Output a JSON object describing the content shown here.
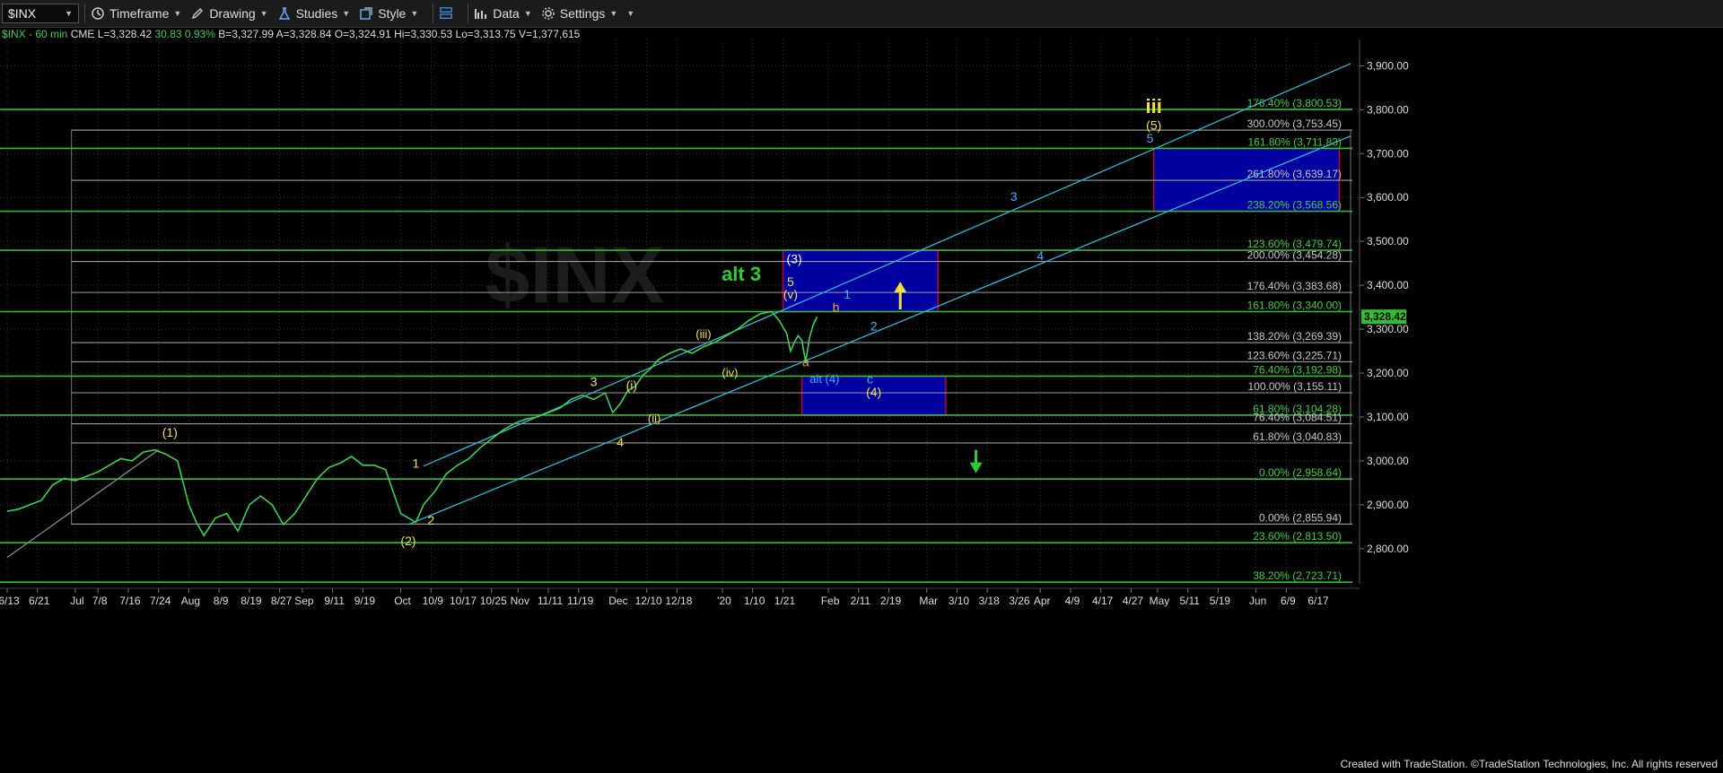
{
  "toolbar": {
    "symbol": "$INX",
    "timeframe_label": "Timeframe",
    "drawing_label": "Drawing",
    "studies_label": "Studies",
    "style_label": "Style",
    "data_label": "Data",
    "settings_label": "Settings"
  },
  "quote": {
    "symbol_interval": "$INX - 60 min",
    "exchange": "CME",
    "last": "L=3,328.42",
    "change": "30.83",
    "change_pct": "0.93%",
    "bid": "B=3,327.99",
    "ask": "A=3,328.84",
    "open": "O=3,324.91",
    "high": "Hi=3,330.53",
    "low": "Lo=3,313.75",
    "volume": "V=1,377,615"
  },
  "footer": {
    "credit": "Created with TradeStation. ©TradeStation Technologies, Inc. All rights reserved"
  },
  "colors": {
    "background": "#000000",
    "grid": "#2a3a2a",
    "price": "#39d353",
    "level_green": "#2fbf2f",
    "level_gray": "#9a9a9a",
    "channel": "#2fb8d8",
    "box_fill": "#0000a0",
    "box_border": "#c00030",
    "yellow": "#f0e040",
    "cyan": "#40b0ff",
    "orange": "#f0a030"
  },
  "chart_data": {
    "type": "line",
    "title": "",
    "xlabel": "",
    "ylabel": "",
    "watermark": "$INX",
    "ylim": [
      2720,
      3960
    ],
    "y_ticks": [
      "2,800.00",
      "2,900.00",
      "3,000.00",
      "3,100.00",
      "3,200.00",
      "3,300.00",
      "3,400.00",
      "3,500.00",
      "3,600.00",
      "3,700.00",
      "3,800.00",
      "3,900.00"
    ],
    "y_tick_values": [
      2800,
      2900,
      3000,
      3100,
      3200,
      3300,
      3400,
      3500,
      3600,
      3700,
      3800,
      3900
    ],
    "last_price_label": "3,328.42",
    "last_price": 3328.42,
    "x_labels": [
      "6/13",
      "6/21",
      "Jul",
      "7/8",
      "7/16",
      "7/24",
      "Aug",
      "8/9",
      "8/19",
      "8/27",
      "Sep",
      "9/11",
      "9/19",
      "Oct",
      "10/9",
      "10/17",
      "10/25",
      "Nov",
      "11/11",
      "11/19",
      "Dec",
      "12/10",
      "12/18",
      "'20",
      "1/10",
      "1/21",
      "Feb",
      "2/11",
      "2/19",
      "Mar",
      "3/10",
      "3/18",
      "3/26",
      "Apr",
      "4/9",
      "4/17",
      "4/27",
      "May",
      "5/11",
      "5/19",
      "Jun",
      "6/9",
      "6/17"
    ],
    "x_index": [
      0,
      8,
      18,
      24,
      32,
      40,
      48,
      56,
      64,
      72,
      78,
      86,
      94,
      104,
      112,
      120,
      128,
      135,
      143,
      151,
      161,
      169,
      177,
      189,
      197,
      205,
      217,
      225,
      233,
      243,
      251,
      259,
      267,
      273,
      281,
      289,
      297,
      304,
      312,
      320,
      330,
      338,
      346
    ],
    "x_max": 355,
    "series": [
      {
        "values_note": "",
        "x": [
          0,
          3,
          6,
          9,
          12,
          15,
          18,
          21,
          24,
          27,
          30,
          33,
          36,
          39,
          42,
          45,
          48,
          50,
          52,
          55,
          58,
          61,
          64,
          67,
          70,
          73,
          76,
          79,
          82,
          85,
          88,
          91,
          94,
          97,
          100,
          102,
          104,
          106,
          108,
          110,
          113,
          116,
          119,
          122,
          125,
          128,
          131,
          134,
          137,
          140,
          143,
          146,
          149,
          152,
          155,
          158,
          160,
          162,
          164,
          166,
          168,
          170,
          172,
          175,
          178,
          181,
          184,
          187,
          190,
          193,
          196,
          199,
          202,
          204,
          206,
          207,
          208,
          209,
          210,
          211,
          212,
          213,
          214
        ],
        "y": [
          2885,
          2890,
          2900,
          2910,
          2945,
          2960,
          2955,
          2965,
          2975,
          2990,
          3005,
          3000,
          3020,
          3025,
          3015,
          3000,
          2900,
          2860,
          2830,
          2870,
          2880,
          2840,
          2900,
          2920,
          2900,
          2855,
          2880,
          2920,
          2960,
          2985,
          2995,
          3010,
          2990,
          2990,
          2980,
          2930,
          2880,
          2870,
          2860,
          2900,
          2930,
          2970,
          2990,
          3005,
          3030,
          3050,
          3070,
          3085,
          3095,
          3100,
          3110,
          3120,
          3140,
          3150,
          3140,
          3155,
          3110,
          3130,
          3160,
          3170,
          3195,
          3210,
          3230,
          3245,
          3255,
          3245,
          3260,
          3270,
          3285,
          3300,
          3320,
          3335,
          3340,
          3320,
          3290,
          3250,
          3270,
          3285,
          3275,
          3225,
          3280,
          3310,
          3328
        ]
      }
    ],
    "levels": [
      {
        "value": 3800.53,
        "label": "176.40% (3,800.53)",
        "color": "green"
      },
      {
        "value": 3753.45,
        "label": "300.00% (3,753.45)",
        "color": "gray"
      },
      {
        "value": 3711.83,
        "label": "161.80% (3,711.83)",
        "color": "green"
      },
      {
        "value": 3639.17,
        "label": "261.80% (3,639.17)",
        "color": "gray"
      },
      {
        "value": 3568.56,
        "label": "238.20% (3,568.56)",
        "color": "green"
      },
      {
        "value": 3479.74,
        "label": "123.60% (3,479.74)",
        "color": "green"
      },
      {
        "value": 3454.28,
        "label": "200.00% (3,454.28)",
        "color": "gray"
      },
      {
        "value": 3383.68,
        "label": "176.40% (3,383.68)",
        "color": "gray"
      },
      {
        "value": 3340.0,
        "label": "161.80% (3,340.00)",
        "color": "green"
      },
      {
        "value": 3269.39,
        "label": "138.20% (3,269.39)",
        "color": "gray"
      },
      {
        "value": 3225.71,
        "label": "123.60% (3,225.71)",
        "color": "gray"
      },
      {
        "value": 3192.98,
        "label": "76.40% (3,192.98)",
        "color": "green"
      },
      {
        "value": 3155.11,
        "label": "100.00% (3,155.11)",
        "color": "gray"
      },
      {
        "value": 3104.28,
        "label": "61.80% (3,104.28)",
        "color": "green"
      },
      {
        "value": 3084.51,
        "label": "76.40% (3,084.51)",
        "color": "gray"
      },
      {
        "value": 3040.83,
        "label": "61.80% (3,040.83)",
        "color": "gray"
      },
      {
        "value": 2958.64,
        "label": "0.00% (2,958.64)",
        "color": "green"
      },
      {
        "value": 2855.94,
        "label": "0.00% (2,855.94)",
        "color": "gray"
      },
      {
        "value": 2813.5,
        "label": "23.60% (2,813.50)",
        "color": "green"
      },
      {
        "value": 2723.71,
        "label": "38.20% (2,723.71)",
        "color": "green"
      }
    ],
    "target_boxes": [
      {
        "x0": 303,
        "x1": 352,
        "y0": 3568.56,
        "y1": 3711.83
      },
      {
        "x0": 205,
        "x1": 246,
        "y0": 3340.0,
        "y1": 3479.74
      },
      {
        "x0": 210,
        "x1": 248,
        "y0": 3104.28,
        "y1": 3192.98
      }
    ],
    "channel_lines": [
      {
        "x0": 110,
        "y0": 2988,
        "x1": 355,
        "y1": 3905
      },
      {
        "x0": 106,
        "y0": 2855,
        "x1": 355,
        "y1": 3740
      },
      {
        "x0": 0,
        "y0": 2780,
        "x1": 40,
        "y1": 3025
      }
    ],
    "annotations": [
      {
        "text": "(1)",
        "x": 43,
        "y": 3055,
        "color": "yellow"
      },
      {
        "text": "(2)",
        "x": 106,
        "y": 2808,
        "color": "yellow"
      },
      {
        "text": "1",
        "x": 108,
        "y": 2985,
        "color": "yellow"
      },
      {
        "text": "2",
        "x": 112,
        "y": 2855,
        "color": "yellow"
      },
      {
        "text": "3",
        "x": 155,
        "y": 3170,
        "color": "yellow"
      },
      {
        "text": "4",
        "x": 162,
        "y": 3033,
        "color": "yellow"
      },
      {
        "text": "(i)",
        "x": 165,
        "y": 3162,
        "color": "yellow"
      },
      {
        "text": "(ii)",
        "x": 171,
        "y": 3088,
        "color": "yellow"
      },
      {
        "text": "(iii)",
        "x": 184,
        "y": 3280,
        "color": "yellow"
      },
      {
        "text": "(iv)",
        "x": 191,
        "y": 3192,
        "color": "yellow"
      },
      {
        "text": "(v)",
        "x": 207,
        "y": 3370,
        "color": "yellow"
      },
      {
        "text": "5",
        "x": 207,
        "y": 3398,
        "color": "yellow"
      },
      {
        "text": "(3)",
        "x": 208,
        "y": 3450,
        "color": "white"
      },
      {
        "text": "alt 3",
        "x": 194,
        "y": 3410,
        "color": "green"
      },
      {
        "text": "a",
        "x": 211,
        "y": 3215,
        "color": "orange"
      },
      {
        "text": "b",
        "x": 219,
        "y": 3340,
        "color": "orange"
      },
      {
        "text": "c",
        "x": 228,
        "y": 3177,
        "color": "cyan"
      },
      {
        "text": "alt (4)",
        "x": 216,
        "y": 3178,
        "color": "cyan"
      },
      {
        "text": "(4)",
        "x": 229,
        "y": 3147,
        "color": "yellow"
      },
      {
        "text": "1",
        "x": 222,
        "y": 3370,
        "color": "cyan"
      },
      {
        "text": "2",
        "x": 229,
        "y": 3297,
        "color": "cyan"
      },
      {
        "text": "3",
        "x": 266,
        "y": 3592,
        "color": "cyan"
      },
      {
        "text": "4",
        "x": 273,
        "y": 3457,
        "color": "cyan"
      },
      {
        "text": "5",
        "x": 302,
        "y": 3725,
        "color": "cyan"
      },
      {
        "text": "(5)",
        "x": 303,
        "y": 3755,
        "color": "yellow"
      },
      {
        "text": "iii",
        "x": 303,
        "y": 3792,
        "color": "yellow"
      }
    ],
    "arrows": [
      {
        "direction": "up",
        "x": 236,
        "y0": 3345,
        "y1": 3400,
        "color": "yellow"
      },
      {
        "direction": "down",
        "x": 256,
        "y0": 3025,
        "y1": 2980,
        "color": "green"
      }
    ],
    "grid": true
  }
}
